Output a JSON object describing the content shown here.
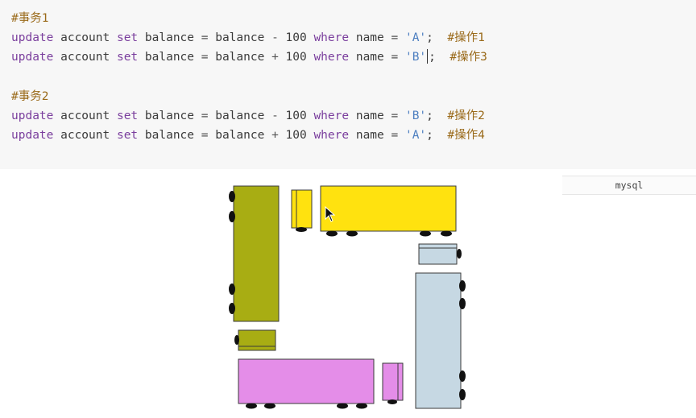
{
  "code": {
    "lines": [
      [
        {
          "t": "#事务1",
          "c": "cm"
        }
      ],
      [
        {
          "t": "update",
          "c": "kw"
        },
        {
          "t": " account ",
          "c": ""
        },
        {
          "t": "set",
          "c": "kw"
        },
        {
          "t": " balance ",
          "c": ""
        },
        {
          "t": "=",
          "c": "op"
        },
        {
          "t": " balance ",
          "c": ""
        },
        {
          "t": "-",
          "c": "op"
        },
        {
          "t": " 100 ",
          "c": ""
        },
        {
          "t": "where",
          "c": "kw"
        },
        {
          "t": " name ",
          "c": ""
        },
        {
          "t": "=",
          "c": "op"
        },
        {
          "t": " ",
          "c": ""
        },
        {
          "t": "'A'",
          "c": "str"
        },
        {
          "t": ";  ",
          "c": ""
        },
        {
          "t": "#操作1",
          "c": "cm"
        }
      ],
      [
        {
          "t": "update",
          "c": "kw"
        },
        {
          "t": " account ",
          "c": ""
        },
        {
          "t": "set",
          "c": "kw"
        },
        {
          "t": " balance ",
          "c": ""
        },
        {
          "t": "=",
          "c": "op"
        },
        {
          "t": " balance ",
          "c": ""
        },
        {
          "t": "+",
          "c": "op"
        },
        {
          "t": " 100 ",
          "c": ""
        },
        {
          "t": "where",
          "c": "kw"
        },
        {
          "t": " name ",
          "c": ""
        },
        {
          "t": "=",
          "c": "op"
        },
        {
          "t": " ",
          "c": ""
        },
        {
          "t": "'B'",
          "c": "str"
        },
        {
          "t": "|",
          "c": "caret"
        },
        {
          "t": ";  ",
          "c": ""
        },
        {
          "t": "#操作3",
          "c": "cm"
        }
      ],
      [],
      [
        {
          "t": "#事务2",
          "c": "cm"
        }
      ],
      [
        {
          "t": "update",
          "c": "kw"
        },
        {
          "t": " account ",
          "c": ""
        },
        {
          "t": "set",
          "c": "kw"
        },
        {
          "t": " balance ",
          "c": ""
        },
        {
          "t": "=",
          "c": "op"
        },
        {
          "t": " balance ",
          "c": ""
        },
        {
          "t": "-",
          "c": "op"
        },
        {
          "t": " 100 ",
          "c": ""
        },
        {
          "t": "where",
          "c": "kw"
        },
        {
          "t": " name ",
          "c": ""
        },
        {
          "t": "=",
          "c": "op"
        },
        {
          "t": " ",
          "c": ""
        },
        {
          "t": "'B'",
          "c": "str"
        },
        {
          "t": ";  ",
          "c": ""
        },
        {
          "t": "#操作2",
          "c": "cm"
        }
      ],
      [
        {
          "t": "update",
          "c": "kw"
        },
        {
          "t": " account ",
          "c": ""
        },
        {
          "t": "set",
          "c": "kw"
        },
        {
          "t": " balance ",
          "c": ""
        },
        {
          "t": "=",
          "c": "op"
        },
        {
          "t": " balance ",
          "c": ""
        },
        {
          "t": "+",
          "c": "op"
        },
        {
          "t": " 100 ",
          "c": ""
        },
        {
          "t": "where",
          "c": "kw"
        },
        {
          "t": " name ",
          "c": ""
        },
        {
          "t": "=",
          "c": "op"
        },
        {
          "t": " ",
          "c": ""
        },
        {
          "t": "'A'",
          "c": "str"
        },
        {
          "t": ";  ",
          "c": ""
        },
        {
          "t": "#操作4",
          "c": "cm"
        }
      ]
    ]
  },
  "language_label": "mysql",
  "diagram": {
    "colors": {
      "olive": "#a8ad13",
      "yellow": "#ffe20f",
      "light_blue": "#c6d8e3",
      "magenta": "#e48de8",
      "wheel": "#111111",
      "outline": "#3a3a3a"
    },
    "icons": [
      "truck-icon",
      "car-icon",
      "wheel-icon",
      "mouse-pointer-icon"
    ]
  }
}
